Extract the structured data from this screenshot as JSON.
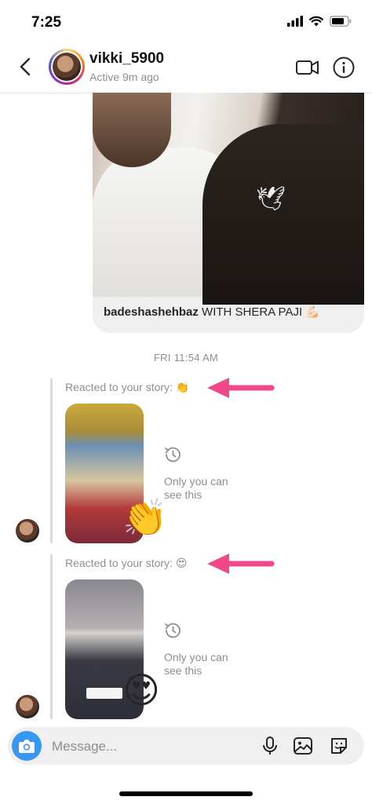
{
  "status_bar": {
    "time": "7:25"
  },
  "header": {
    "username": "vikki_5900",
    "activity": "Active 9m ago",
    "icons": [
      "back-chevron-icon",
      "video-call-icon",
      "info-icon"
    ]
  },
  "shared_post": {
    "caption_user": "badeshashehbaz",
    "caption_text": "WITH SHERA PAJI",
    "caption_emoji": "💪🏻"
  },
  "timestamp": "FRI 11:54 AM",
  "reactions": [
    {
      "label": "Reacted to your story:",
      "emoji": "👏",
      "big_emoji": "👏",
      "note_line1": "Only you can",
      "note_line2": "see this"
    },
    {
      "label": "Reacted to your story:",
      "emoji": "😍",
      "big_emoji": "😍",
      "note_line1": "Only you can",
      "note_line2": "see this"
    }
  ],
  "composer": {
    "placeholder": "Message..."
  },
  "colors": {
    "annotation_arrow": "#f0498a",
    "camera_button": "#3897f0",
    "muted_text": "#8e8e8e"
  }
}
